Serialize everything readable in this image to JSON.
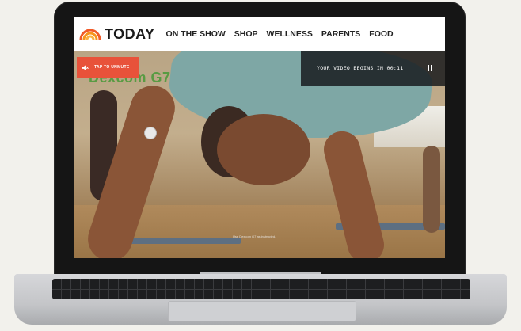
{
  "nav": {
    "logo_text": "TODAY",
    "links": [
      "ON THE SHOW",
      "SHOP",
      "WELLNESS",
      "PARENTS",
      "FOOD"
    ]
  },
  "video": {
    "brand_overlay": "Dexcom G7",
    "unmute_label": "TAP TO UNMUTE",
    "countdown_text": "YOUR VIDEO BEGINS IN 00:11",
    "disclaimer": "Use Dexcom G7 as instructed."
  },
  "icons": {
    "logo": "today-rainbow-icon",
    "unmute": "speaker-muted-icon",
    "pause": "pause-icon"
  },
  "colors": {
    "unmute_bg": "#e8523a",
    "overlay_bg": "#14161a",
    "brand_green": "#4f9a3c"
  }
}
